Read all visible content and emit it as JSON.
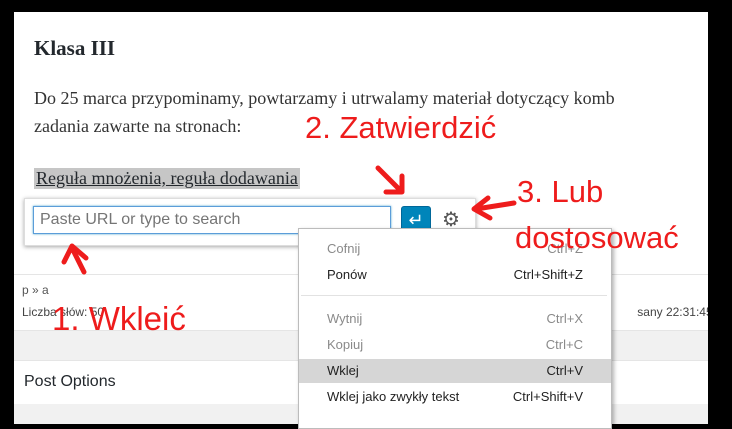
{
  "heading": "Klasa III",
  "paragraph_line1": "Do 25 marca przypominamy, powtarzamy i utrwalamy materiał dotyczący komb",
  "paragraph_line2": "zadania zawarte na stronach:",
  "link_text": "Reguła mnożenia, reguła dodawania",
  "link_editor": {
    "placeholder": "Paste URL or type to search",
    "apply_icon": "enter-icon",
    "settings_icon": "gear-icon"
  },
  "status": {
    "path": "p » a",
    "word_count_label": "Liczba słów: 50",
    "saved_text": "sany 22:31:45."
  },
  "post_options_label": "Post Options",
  "context_menu": [
    {
      "label": "Cofnij",
      "shortcut": "Ctrl+Z",
      "enabled": false
    },
    {
      "label": "Ponów",
      "shortcut": "Ctrl+Shift+Z",
      "enabled": true
    },
    {
      "label": "Wytnij",
      "shortcut": "Ctrl+X",
      "enabled": false
    },
    {
      "label": "Kopiuj",
      "shortcut": "Ctrl+C",
      "enabled": false
    },
    {
      "label": "Wklej",
      "shortcut": "Ctrl+V",
      "enabled": true,
      "highlighted": true
    },
    {
      "label": "Wklej jako zwykły tekst",
      "shortcut": "Ctrl+Shift+V",
      "enabled": true
    }
  ],
  "annotations": {
    "step1": "1. Wkleić",
    "step2": "2. Zatwierdzić",
    "step3_line1": "3. Lub",
    "step3_line2": "dostosować",
    "color": "#ee1c1c"
  }
}
